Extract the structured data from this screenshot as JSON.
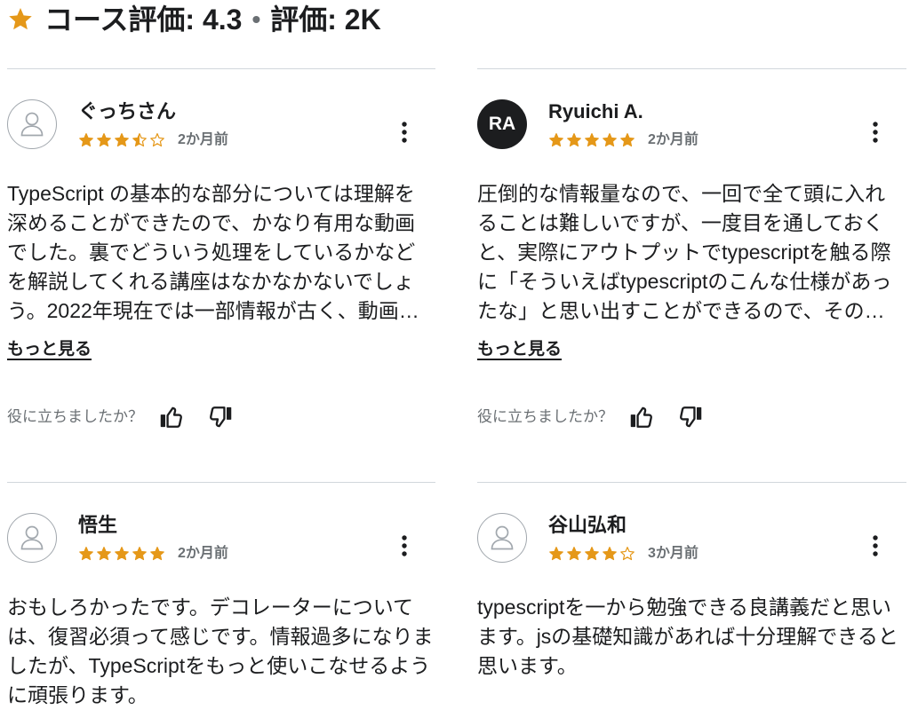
{
  "header": {
    "icon": "star-icon",
    "course_rating": "コース評価: 4.3",
    "separator": "•",
    "rating_count": "評価: 2K"
  },
  "colors": {
    "text": "#1c1d1f",
    "muted": "#6a6f73",
    "divider": "#d1d7dc",
    "star": "#e59819",
    "avatar_dark": "#1c1d1f",
    "avatar_outline": "#a1a7ad"
  },
  "reviews": [
    {
      "name": "ぐっちさん",
      "avatar": {
        "icon": "user-icon"
      },
      "rating": 3.5,
      "date": "2か月前",
      "text": "TypeScript の基本的な部分については理解を\n深めることができたので、かなり有用な動画\nでした。裏でどういう処理をしているかなど\nを解説してくれる講座はなかなかないでしょ\nう。2022年現在では一部情報が古く、動画…",
      "show_more": "もっと見る",
      "helpful_prompt": "役に立ちましたか？",
      "icons": {
        "menu": "more-vertical-icon",
        "helpful_yes": "thumbs-up-icon",
        "helpful_no": "thumbs-down-icon"
      }
    },
    {
      "name": "Ryuichi A.",
      "avatar": {
        "initials": "RA"
      },
      "rating": 5,
      "date": "2か月前",
      "text": "圧倒的な情報量なので、一回で全て頭に入れ\nることは難しいですが、一度目を通しておく\nと、実際にアウトプットでtypescriptを触る際\nに「そういえばtypescriptのこんな仕様があっ\nたな」と思い出すことができるので、その…",
      "show_more": "もっと見る",
      "helpful_prompt": "役に立ちましたか？",
      "icons": {
        "menu": "more-vertical-icon",
        "helpful_yes": "thumbs-up-icon",
        "helpful_no": "thumbs-down-icon"
      }
    },
    {
      "name": "悟生",
      "avatar": {
        "icon": "user-icon"
      },
      "rating": 5,
      "date": "2か月前",
      "text": "おもしろかったです。デコレーターについて\nは、復習必須って感じです。情報過多になりま\nしたが、TypeScriptをもっと使いこなせるよう\nに頑張ります。",
      "icons": {
        "menu": "more-vertical-icon"
      }
    },
    {
      "name": "谷山弘和",
      "avatar": {
        "icon": "user-icon"
      },
      "rating": 4,
      "date": "3か月前",
      "text": "typescriptを一から勉強できる良講義だと思い\nます。jsの基礎知識があれば十分理解できると\n思います。",
      "icons": {
        "menu": "more-vertical-icon"
      }
    }
  ]
}
